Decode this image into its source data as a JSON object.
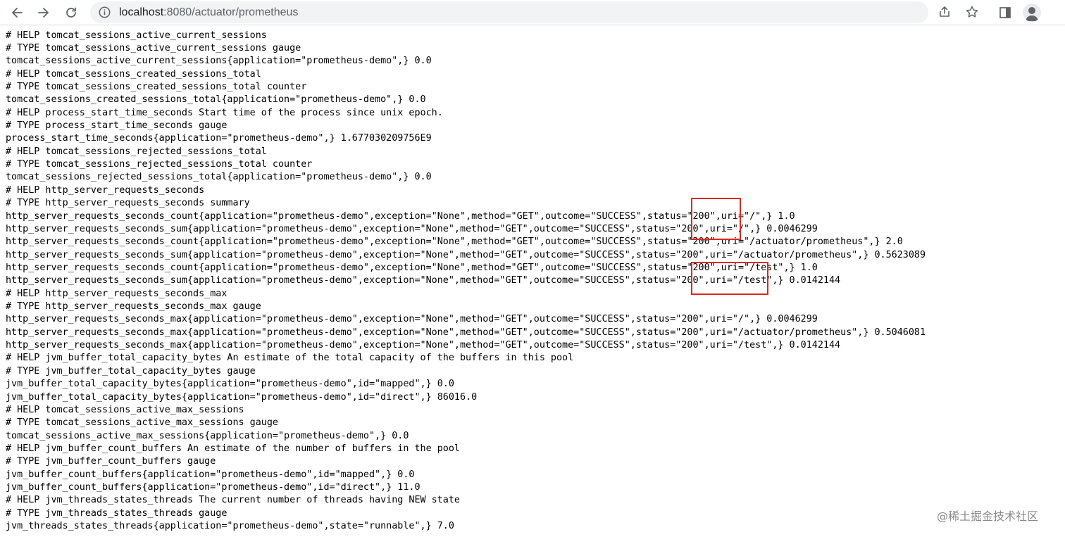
{
  "browser": {
    "url_host": "localhost",
    "url_path": ":8080/actuator/prometheus",
    "icons": [
      "back-arrow-icon",
      "forward-arrow-icon",
      "reload-icon",
      "info-icon",
      "share-icon",
      "bookmark-star-icon",
      "side-panel-icon",
      "profile-avatar-icon"
    ]
  },
  "metrics_lines": [
    "# HELP tomcat_sessions_active_current_sessions",
    "# TYPE tomcat_sessions_active_current_sessions gauge",
    "tomcat_sessions_active_current_sessions{application=\"prometheus-demo\",} 0.0",
    "# HELP tomcat_sessions_created_sessions_total",
    "# TYPE tomcat_sessions_created_sessions_total counter",
    "tomcat_sessions_created_sessions_total{application=\"prometheus-demo\",} 0.0",
    "# HELP process_start_time_seconds Start time of the process since unix epoch.",
    "# TYPE process_start_time_seconds gauge",
    "process_start_time_seconds{application=\"prometheus-demo\",} 1.677030209756E9",
    "# HELP tomcat_sessions_rejected_sessions_total",
    "# TYPE tomcat_sessions_rejected_sessions_total counter",
    "tomcat_sessions_rejected_sessions_total{application=\"prometheus-demo\",} 0.0",
    "# HELP http_server_requests_seconds",
    "# TYPE http_server_requests_seconds summary",
    "http_server_requests_seconds_count{application=\"prometheus-demo\",exception=\"None\",method=\"GET\",outcome=\"SUCCESS\",status=\"200\",uri=\"/\",} 1.0",
    "http_server_requests_seconds_sum{application=\"prometheus-demo\",exception=\"None\",method=\"GET\",outcome=\"SUCCESS\",status=\"200\",uri=\"/\",} 0.0046299",
    "http_server_requests_seconds_count{application=\"prometheus-demo\",exception=\"None\",method=\"GET\",outcome=\"SUCCESS\",status=\"200\",uri=\"/actuator/prometheus\",} 2.0",
    "http_server_requests_seconds_sum{application=\"prometheus-demo\",exception=\"None\",method=\"GET\",outcome=\"SUCCESS\",status=\"200\",uri=\"/actuator/prometheus\",} 0.5623089",
    "http_server_requests_seconds_count{application=\"prometheus-demo\",exception=\"None\",method=\"GET\",outcome=\"SUCCESS\",status=\"200\",uri=\"/test\",} 1.0",
    "http_server_requests_seconds_sum{application=\"prometheus-demo\",exception=\"None\",method=\"GET\",outcome=\"SUCCESS\",status=\"200\",uri=\"/test\",} 0.0142144",
    "# HELP http_server_requests_seconds_max",
    "# TYPE http_server_requests_seconds_max gauge",
    "http_server_requests_seconds_max{application=\"prometheus-demo\",exception=\"None\",method=\"GET\",outcome=\"SUCCESS\",status=\"200\",uri=\"/\",} 0.0046299",
    "http_server_requests_seconds_max{application=\"prometheus-demo\",exception=\"None\",method=\"GET\",outcome=\"SUCCESS\",status=\"200\",uri=\"/actuator/prometheus\",} 0.5046081",
    "http_server_requests_seconds_max{application=\"prometheus-demo\",exception=\"None\",method=\"GET\",outcome=\"SUCCESS\",status=\"200\",uri=\"/test\",} 0.0142144",
    "# HELP jvm_buffer_total_capacity_bytes An estimate of the total capacity of the buffers in this pool",
    "# TYPE jvm_buffer_total_capacity_bytes gauge",
    "jvm_buffer_total_capacity_bytes{application=\"prometheus-demo\",id=\"mapped\",} 0.0",
    "jvm_buffer_total_capacity_bytes{application=\"prometheus-demo\",id=\"direct\",} 86016.0",
    "# HELP tomcat_sessions_active_max_sessions",
    "# TYPE tomcat_sessions_active_max_sessions gauge",
    "tomcat_sessions_active_max_sessions{application=\"prometheus-demo\",} 0.0",
    "# HELP jvm_buffer_count_buffers An estimate of the number of buffers in the pool",
    "# TYPE jvm_buffer_count_buffers gauge",
    "jvm_buffer_count_buffers{application=\"prometheus-demo\",id=\"mapped\",} 0.0",
    "jvm_buffer_count_buffers{application=\"prometheus-demo\",id=\"direct\",} 11.0",
    "# HELP jvm_threads_states_threads The current number of threads having NEW state",
    "# TYPE jvm_threads_states_threads gauge",
    "jvm_threads_states_threads{application=\"prometheus-demo\",state=\"runnable\",} 7.0"
  ],
  "annotations": {
    "highlight_color": "#e0261f"
  },
  "watermark": "@稀土掘金技术社区"
}
